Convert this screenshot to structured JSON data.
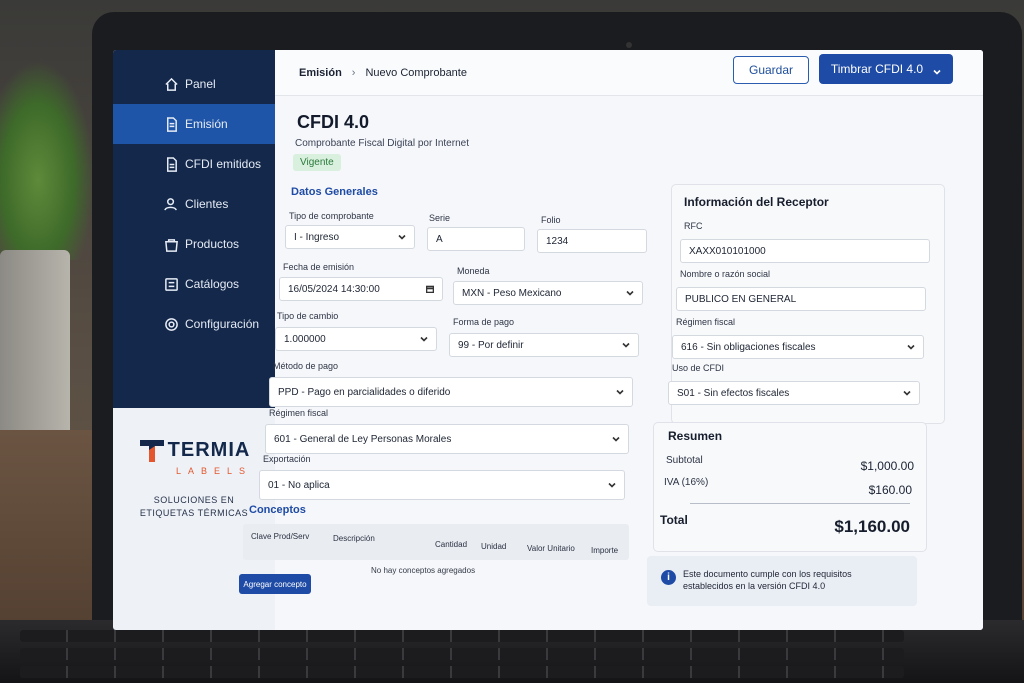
{
  "sidebar": {
    "items": [
      {
        "label": "Panel",
        "icon": "home-icon",
        "active": false
      },
      {
        "label": "Emisión",
        "icon": "document-icon",
        "active": true
      },
      {
        "label": "CFDI emitidos",
        "icon": "documents-icon",
        "active": false
      },
      {
        "label": "Clientes",
        "icon": "users-icon",
        "active": false
      },
      {
        "label": "Productos",
        "icon": "bag-icon",
        "active": false
      },
      {
        "label": "Catálogos",
        "icon": "catalog-icon",
        "active": false
      },
      {
        "label": "Configuración",
        "icon": "gear-icon",
        "active": false
      }
    ],
    "brand": {
      "name": "TERMIA",
      "sub": "LABELS",
      "tagline_1": "SOLUCIONES EN",
      "tagline_2": "ETIQUETAS TÉRMICAS"
    }
  },
  "header": {
    "breadcrumb_root": "Emisión",
    "breadcrumb_sep": "›",
    "breadcrumb_current": "Nuevo Comprobante",
    "save_label": "Guardar",
    "stamp_label": "Timbrar CFDI 4.0"
  },
  "doc": {
    "title": "CFDI 4.0",
    "subtitle": "Comprobante Fiscal Digital por Internet",
    "status": "Vigente"
  },
  "general": {
    "title": "Datos Generales",
    "tipo_label": "Tipo de comprobante",
    "tipo_value": "I - Ingreso",
    "serie_label": "Serie",
    "serie_value": "A",
    "folio_label": "Folio",
    "folio_value": "1234",
    "fecha_label": "Fecha de emisión",
    "fecha_value": "16/05/2024 14:30:00",
    "moneda_label": "Moneda",
    "moneda_value": "MXN - Peso Mexicano",
    "cambio_label": "Tipo de cambio",
    "cambio_value": "1.000000",
    "forma_label": "Forma de pago",
    "forma_value": "99 - Por definir",
    "metodo_label": "Método de pago",
    "metodo_value": "PPD - Pago en parcialidades o diferido",
    "regimen_label": "Régimen fiscal",
    "regimen_value": "601 - General de Ley Personas Morales",
    "export_label": "Exportación",
    "export_value": "01 - No aplica"
  },
  "receptor": {
    "title": "Información del Receptor",
    "rfc_label": "RFC",
    "rfc_value": "XAXX010101000",
    "nombre_label": "Nombre o razón social",
    "nombre_value": "PUBLICO EN GENERAL",
    "regimen_label": "Régimen fiscal",
    "regimen_value": "616 - Sin obligaciones fiscales",
    "uso_label": "Uso de CFDI",
    "uso_value": "S01 - Sin efectos fiscales"
  },
  "resumen": {
    "title": "Resumen",
    "subtotal_label": "Subtotal",
    "subtotal_value": "$1,000.00",
    "iva_label": "IVA (16%)",
    "iva_value": "$160.00",
    "total_label": "Total",
    "total_value": "$1,160.00"
  },
  "conceptos": {
    "title": "Conceptos",
    "columns": [
      "Clave Prod/Serv",
      "Descripción",
      "Cantidad",
      "Unidad",
      "Valor Unitario",
      "Importe"
    ],
    "empty_text": "No hay conceptos agregados",
    "add_label": "Agregar concepto"
  },
  "info": {
    "icon": "info-icon",
    "text": "Este documento cumple con los requisitos establecidos en la versión CFDI 4.0"
  },
  "colors": {
    "sidebar": "#13284a",
    "accent": "#1e4ba6",
    "active": "#1e55a8",
    "badge_bg": "#d8f0dd",
    "badge_text": "#2d7a3d",
    "brand_orange": "#e4572e"
  }
}
